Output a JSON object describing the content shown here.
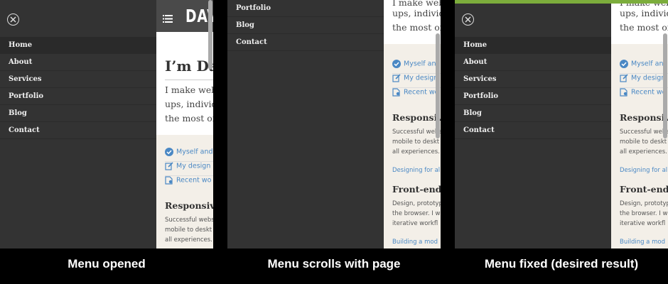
{
  "captions": [
    "Menu opened",
    "Menu scrolls with page",
    "Menu fixed (desired result)"
  ],
  "colors": {
    "accent_green": "#7cad3c",
    "menu_bg": "#333333",
    "link_blue": "#4a88c4",
    "content_bg": "#f3efe8"
  },
  "menu_items": [
    "Home",
    "About",
    "Services",
    "Portfolio",
    "Blog",
    "Contact"
  ],
  "menu_items_scrolled": [
    "Portfolio",
    "Blog",
    "Contact"
  ],
  "site": {
    "logo": "DAV",
    "hero_title": "I’m Da",
    "hero_lines": [
      "I make web",
      "ups, individ",
      "the most of"
    ],
    "links": [
      {
        "icon": "check-circle-icon",
        "label": "Myself and"
      },
      {
        "icon": "edit-icon",
        "label": "My design"
      },
      {
        "icon": "document-icon",
        "label": "Recent wo"
      }
    ],
    "section1": {
      "heading": "Responsive",
      "lines": [
        "Successful webs",
        "mobile to deskt",
        "all experiences."
      ],
      "link": "Designing for al"
    },
    "section2": {
      "heading": "Front-end I",
      "lines": [
        "Design, prototyp",
        "the browser. I w",
        "iterative workfl"
      ],
      "link": "Building a mod"
    }
  }
}
